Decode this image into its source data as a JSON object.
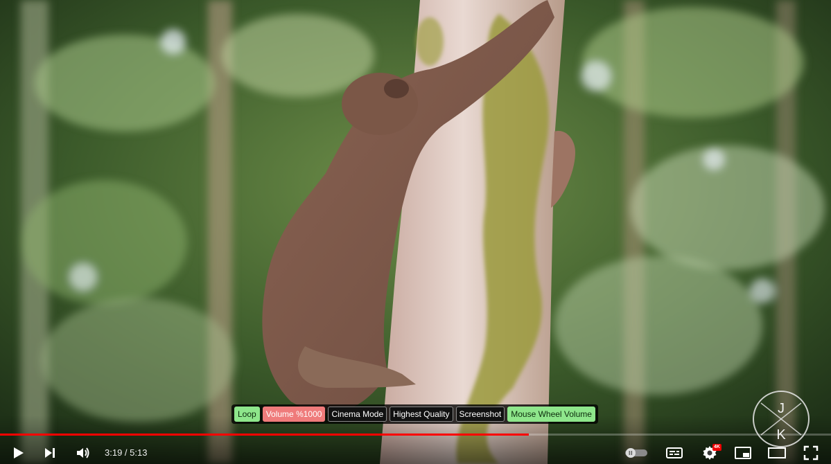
{
  "video": {
    "scene": "sloth-climbing-tree",
    "progress": {
      "current": "3:19",
      "duration": "5:13",
      "separator": " / ",
      "fraction": 0.636
    }
  },
  "extension": {
    "buttons": [
      {
        "label": "Loop",
        "state": "on",
        "color": "#8ee68b"
      },
      {
        "label": "Volume %1000",
        "state": "on",
        "color": "#ef7b7b"
      },
      {
        "label": "Cinema Mode",
        "state": "off"
      },
      {
        "label": "Highest Quality",
        "state": "off"
      },
      {
        "label": "Screenshot",
        "state": "off"
      },
      {
        "label": "Mouse Wheel Volume",
        "state": "on",
        "color": "#8ee68b"
      }
    ]
  },
  "controls": {
    "play_icon": "play-icon",
    "next_icon": "next-icon",
    "volume_icon": "volume-icon",
    "autoplay_icon": "autoplay-toggle-icon",
    "subtitles_icon": "subtitles-icon",
    "settings_icon": "gear-icon",
    "quality_badge": "4K",
    "miniplayer_icon": "miniplayer-icon",
    "theater_icon": "theater-mode-icon",
    "fullscreen_icon": "fullscreen-icon"
  },
  "watermark": {
    "letters": [
      "J",
      "K"
    ],
    "icon": "channel-watermark-icon"
  },
  "colors": {
    "progress": "#ff0000",
    "text": "#eeeeee",
    "badge": "#ee0000"
  }
}
